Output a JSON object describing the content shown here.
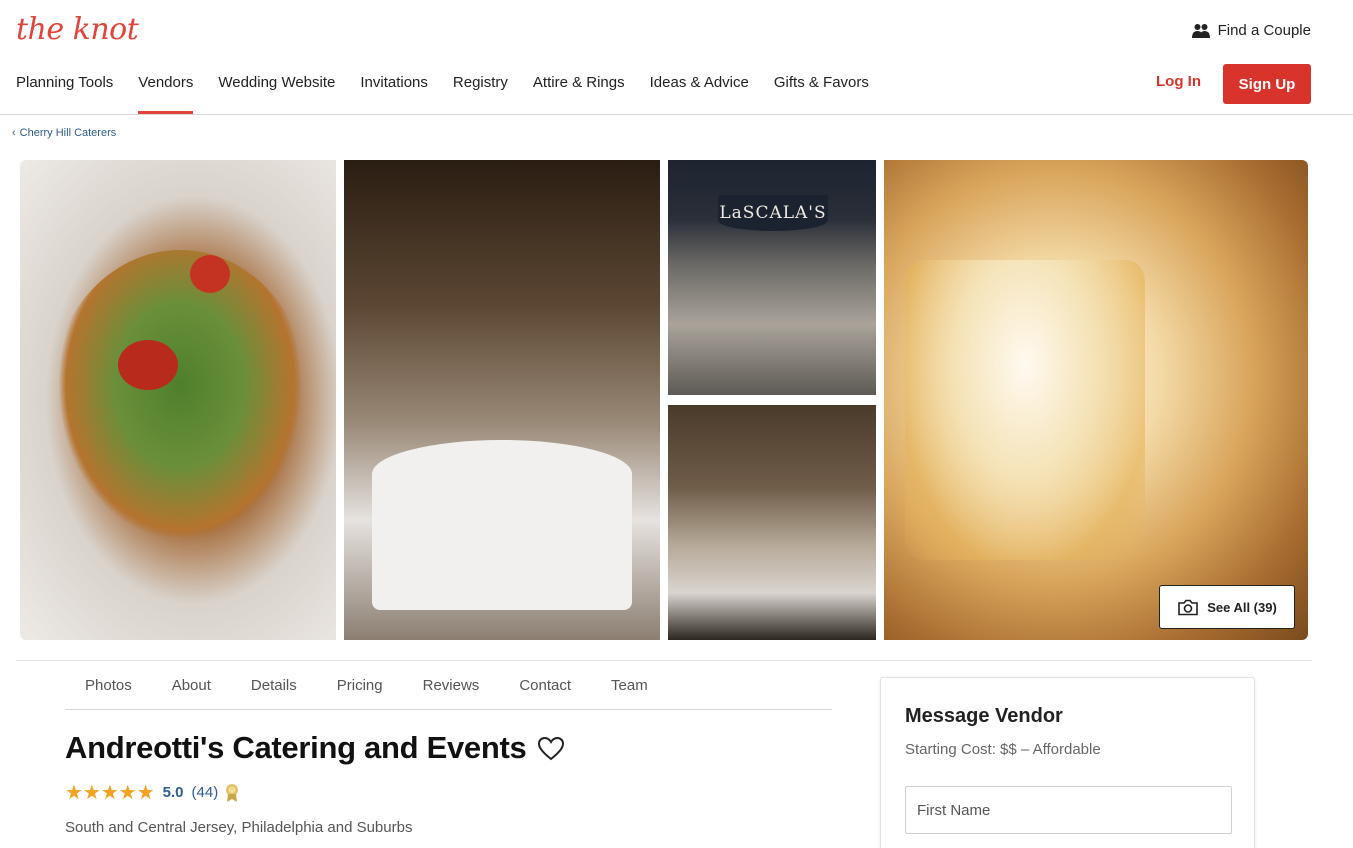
{
  "header": {
    "logo_text": "the knot",
    "find_couple": "Find a Couple",
    "nav": [
      "Planning Tools",
      "Vendors",
      "Wedding Website",
      "Invitations",
      "Registry",
      "Attire & Rings",
      "Ideas & Advice",
      "Gifts & Favors"
    ],
    "active_nav": "Vendors",
    "login": "Log In",
    "signup": "Sign Up"
  },
  "breadcrumb": {
    "label": "Cherry Hill Caterers"
  },
  "gallery": {
    "sign_text": "LaSCALA'S",
    "see_all": "See All (39)"
  },
  "subtabs": [
    "Photos",
    "About",
    "Details",
    "Pricing",
    "Reviews",
    "Contact",
    "Team"
  ],
  "vendor": {
    "name": "Andreotti's Catering and Events",
    "stars": "★★★★★",
    "rating": "5.0",
    "review_count": "(44)",
    "location": "South and Central Jersey, Philadelphia and Suburbs"
  },
  "message_card": {
    "title": "Message Vendor",
    "starting_cost": "Starting Cost: $$ – Affordable",
    "first_name_placeholder": "First Name"
  },
  "colors": {
    "brand_red": "#d9342b",
    "link_blue": "#2f5b9a",
    "star_orange": "#f3a11f"
  }
}
